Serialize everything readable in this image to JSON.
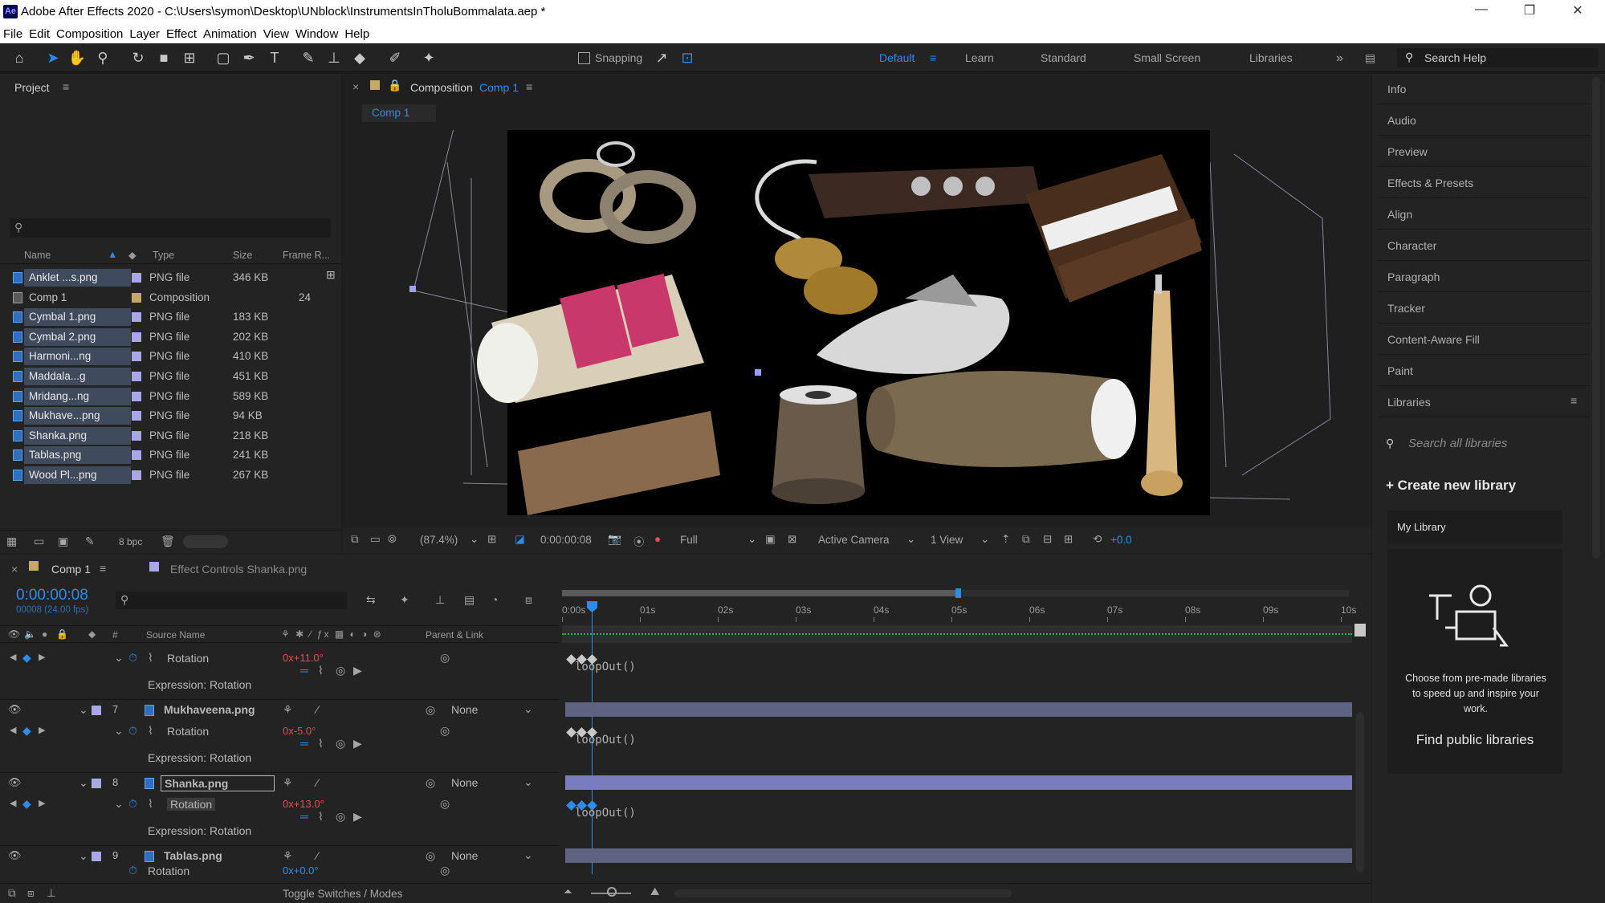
{
  "app": {
    "icon_text": "Ae",
    "title": "Adobe After Effects 2020 - C:\\Users\\symon\\Desktop\\UNblock\\InstrumentsInTholuBommalata.aep *"
  },
  "menu": [
    "File",
    "Edit",
    "Composition",
    "Layer",
    "Effect",
    "Animation",
    "View",
    "Window",
    "Help"
  ],
  "toolbar": {
    "snapping_label": "Snapping",
    "workspaces": [
      "Default",
      "Learn",
      "Standard",
      "Small Screen",
      "Libraries"
    ],
    "active_workspace": "Default",
    "search_placeholder": "Search Help"
  },
  "project": {
    "title": "Project",
    "search_placeholder": "",
    "columns": {
      "name": "Name",
      "type": "Type",
      "size": "Size",
      "frame_rate": "Frame R..."
    },
    "items": [
      {
        "name": "Anklet ...s.png",
        "type": "PNG file",
        "size": "346 KB",
        "frame_rate": "",
        "kind": "png"
      },
      {
        "name": "Comp 1",
        "type": "Composition",
        "size": "",
        "frame_rate": "24",
        "kind": "comp"
      },
      {
        "name": "Cymbal 1.png",
        "type": "PNG file",
        "size": "183 KB",
        "frame_rate": "",
        "kind": "png"
      },
      {
        "name": "Cymbal 2.png",
        "type": "PNG file",
        "size": "202 KB",
        "frame_rate": "",
        "kind": "png"
      },
      {
        "name": "Harmoni...ng",
        "type": "PNG file",
        "size": "410 KB",
        "frame_rate": "",
        "kind": "png"
      },
      {
        "name": "Maddala...g",
        "type": "PNG file",
        "size": "451 KB",
        "frame_rate": "",
        "kind": "png"
      },
      {
        "name": "Mridang...ng",
        "type": "PNG file",
        "size": "589 KB",
        "frame_rate": "",
        "kind": "png"
      },
      {
        "name": "Mukhave...png",
        "type": "PNG file",
        "size": "94 KB",
        "frame_rate": "",
        "kind": "png"
      },
      {
        "name": "Shanka.png",
        "type": "PNG file",
        "size": "218 KB",
        "frame_rate": "",
        "kind": "png"
      },
      {
        "name": "Tablas.png",
        "type": "PNG file",
        "size": "241 KB",
        "frame_rate": "",
        "kind": "png"
      },
      {
        "name": "Wood Pl...png",
        "type": "PNG file",
        "size": "267 KB",
        "frame_rate": "",
        "kind": "png"
      }
    ],
    "bpc": "8 bpc"
  },
  "composition": {
    "panel_label": "Composition",
    "comp_name": "Comp 1",
    "tab": "Comp 1",
    "zoom": "(87.4%)",
    "timecode": "0:00:00:08",
    "resolution": "Full",
    "camera": "Active Camera",
    "views": "1 View",
    "exposure": "+0.0"
  },
  "right_panel": {
    "items": [
      "Info",
      "Audio",
      "Preview",
      "Effects & Presets",
      "Align",
      "Character",
      "Paragraph",
      "Tracker",
      "Content-Aware Fill",
      "Paint",
      "Libraries"
    ],
    "lib_search_placeholder": "Search all libraries",
    "create_library": "Create new library",
    "my_library": "My Library",
    "promo_text": "Choose from pre-made libraries to speed up and inspire your work.",
    "find_public": "Find public libraries"
  },
  "timeline": {
    "tab": "Comp 1",
    "effect_controls": "Effect Controls Shanka.png",
    "timecode": "0:00:00:08",
    "timecode_sub": "00008 (24.00 fps)",
    "col_source": "Source Name",
    "col_parent": "Parent & Link",
    "ruler": [
      "0:00s",
      "01s",
      "02s",
      "03s",
      "04s",
      "05s",
      "06s",
      "07s",
      "08s",
      "09s",
      "10s"
    ],
    "layers": [
      {
        "num": "",
        "name": "",
        "rotation_label": "Rotation",
        "rotation_value": "0x+11.0°",
        "expr_label": "Expression: Rotation",
        "expr": "loopOut()",
        "parent": ""
      },
      {
        "num": "7",
        "name": "Mukhaveena.png",
        "rotation_label": "Rotation",
        "rotation_value": "0x-5.0°",
        "expr_label": "Expression: Rotation",
        "expr": "loopOut()",
        "parent": "None"
      },
      {
        "num": "8",
        "name": "Shanka.png",
        "rotation_label": "Rotation",
        "rotation_value": "0x+13.0°",
        "expr_label": "Expression: Rotation",
        "expr": "loopOut()",
        "parent": "None"
      },
      {
        "num": "9",
        "name": "Tablas.png",
        "rotation_label": "Rotation",
        "rotation_value": "0x+0.0°",
        "expr_label": "",
        "expr": "",
        "parent": "None"
      }
    ],
    "toggle_label": "Toggle Switches / Modes"
  },
  "colors": {
    "accent": "#2d8ceb",
    "selected_bar": "#7a7cc0",
    "layer_bar": "#5d6380"
  }
}
